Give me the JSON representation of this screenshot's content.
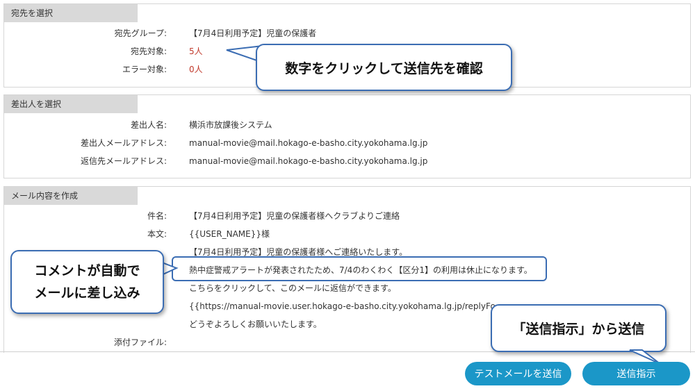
{
  "recipient": {
    "title": "宛先を選択",
    "group_label": "宛先グループ:",
    "group_value": "【7月4日利用予定】児童の保護者",
    "target_label": "宛先対象:",
    "target_value": "5人",
    "error_label": "エラー対象:",
    "error_value": "0人"
  },
  "sender": {
    "title": "差出人を選択",
    "name_label": "差出人名:",
    "name_value": "横浜市放課後システム",
    "email_label": "差出人メールアドレス:",
    "email_value": "manual-movie@mail.hokago-e-basho.city.yokohama.lg.jp",
    "reply_label": "返信先メールアドレス:",
    "reply_value": "manual-movie@mail.hokago-e-basho.city.yokohama.lg.jp"
  },
  "mail": {
    "title": "メール内容を作成",
    "subject_label": "件名:",
    "subject_value": "【7月4日利用予定】児童の保護者様へクラブよりご連絡",
    "body_label": "本文:",
    "body_lines": [
      "{{USER_NAME}}様",
      "【7月4日利用予定】児童の保護者様へご連絡いたします。",
      "熱中症警戒アラートが発表されたため、7/4のわくわく【区分1】の利用は休止になります。",
      "こちらをクリックして、このメールに返信ができます。",
      "{{https://manual-movie.user.hokago-e-basho.city.yokohama.lg.jp/replyFo",
      "どうぞよろしくお願いいたします。"
    ],
    "attach_label": "添付ファイル:"
  },
  "callouts": {
    "click_number": "数字をクリックして送信先を確認",
    "comment_line1": "コメントが自動で",
    "comment_line2": "メールに差し込み",
    "send_from": "「送信指示」から送信"
  },
  "buttons": {
    "test_mail": "テストメールを送信",
    "send": "送信指示"
  },
  "colors": {
    "button": "#1b97c8",
    "callout_border": "#3b6db3",
    "count_red": "#c0392b",
    "panel_header": "#d9d9d9"
  }
}
